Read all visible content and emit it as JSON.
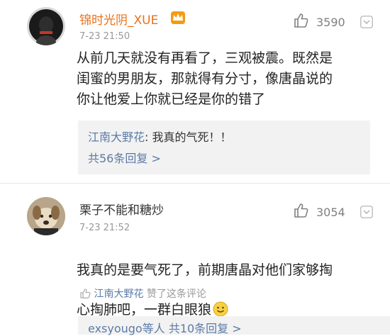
{
  "comments": [
    {
      "username": "锦时光阴_XUE",
      "badge": "crown-badge-icon",
      "time": "7-23 21:50",
      "likes": "3590",
      "text": "从前几天就没有再看了，三观被震。既然是\n闺蜜的男朋友，那就得有分寸，像唐晶说的\n你让他爱上你就已经是你的错了",
      "reply": {
        "user": "江南大野花",
        "separator": ":",
        "text": "我真的气死！！",
        "count": "共56条回复",
        "arrow": ">"
      }
    },
    {
      "username": "栗子不能和糖炒",
      "time": "7-23 21:52",
      "likes": "3054",
      "text": "我真的是要气死了，前期唐晶对他们家够掏\n心掏肺吧，一群白眼狼",
      "liked_by": {
        "user": "江南大野花",
        "text": "赞了这条评论"
      },
      "reply_preview": {
        "user": "exsyougo等人",
        "count": "共10条回复",
        "arrow": ">"
      }
    }
  ],
  "colors": {
    "username_orange": "#e8721c",
    "link_blue": "#5b7ba7",
    "meta_gray": "#999999",
    "reply_bg": "#f2f2f2"
  }
}
